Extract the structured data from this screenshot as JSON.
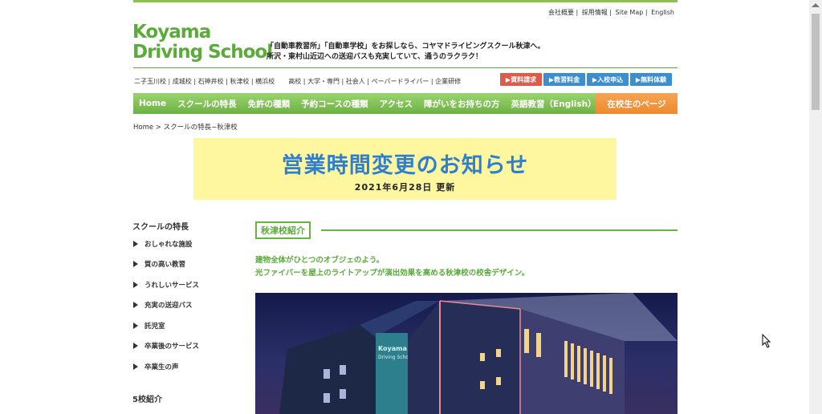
{
  "utility_links": [
    "会社概要",
    "採用情報",
    "Site Map",
    "English"
  ],
  "logo": {
    "line1": "Koyama",
    "line2": "Driving School"
  },
  "tagline": {
    "line1": "「自動車教習所」「自動車学校」をお探しなら、コヤマドライビングスクール秋津へ。",
    "line2": "所沢・東村山近辺への送迎バスも充実していて、通うのラクラク！"
  },
  "branches": [
    "二子玉川校",
    "成城校",
    "石神井校",
    "秋津校",
    "横浜校"
  ],
  "categories": [
    "高校",
    "大学・専門",
    "社会人",
    "ペーパードライバー",
    "企業研修"
  ],
  "quick_buttons": [
    {
      "label": "▶資料請求",
      "color": "#e05a4a"
    },
    {
      "label": "▶教習料金",
      "color": "#3b8ed0"
    },
    {
      "label": "▶入校申込",
      "color": "#3b8ed0"
    },
    {
      "label": "▶無料体験",
      "color": "#3b8ed0"
    }
  ],
  "nav": [
    "Home",
    "スクールの特長",
    "免許の種類",
    "予約コースの種類",
    "アクセス",
    "障がいをお持ちの方",
    "英語教習（English）"
  ],
  "nav_current": "在校生のページ",
  "breadcrumb": "Home > スクールの特長−秋津校",
  "banner": {
    "title": "営業時間変更のお知らせ",
    "updated": "2021年6月28日 更新"
  },
  "sidebar": {
    "heading1": "スクールの特長",
    "items": [
      "おしゃれな施設",
      "質の高い教習",
      "うれしいサービス",
      "充実の送迎バス",
      "託児室",
      "卒業後のサービス",
      "卒業生の声"
    ],
    "heading2": "5校紹介"
  },
  "section": {
    "label": "秋津校紹介",
    "intro1": "建物全体がひとつのオブジェのよう。",
    "intro2": "光ファイバーを屋上のライトアップが演出効果を高める秋津校の校舎デザイン。"
  },
  "photo_sign": {
    "line1": "Koyama",
    "line2": "Driving School"
  },
  "colors": {
    "brand_green": "#5aab3a",
    "nav_green": "#6cb144",
    "current_orange": "#ec8a2c",
    "banner_bg": "#fff7a0",
    "banner_blue": "#2f7fd0"
  }
}
